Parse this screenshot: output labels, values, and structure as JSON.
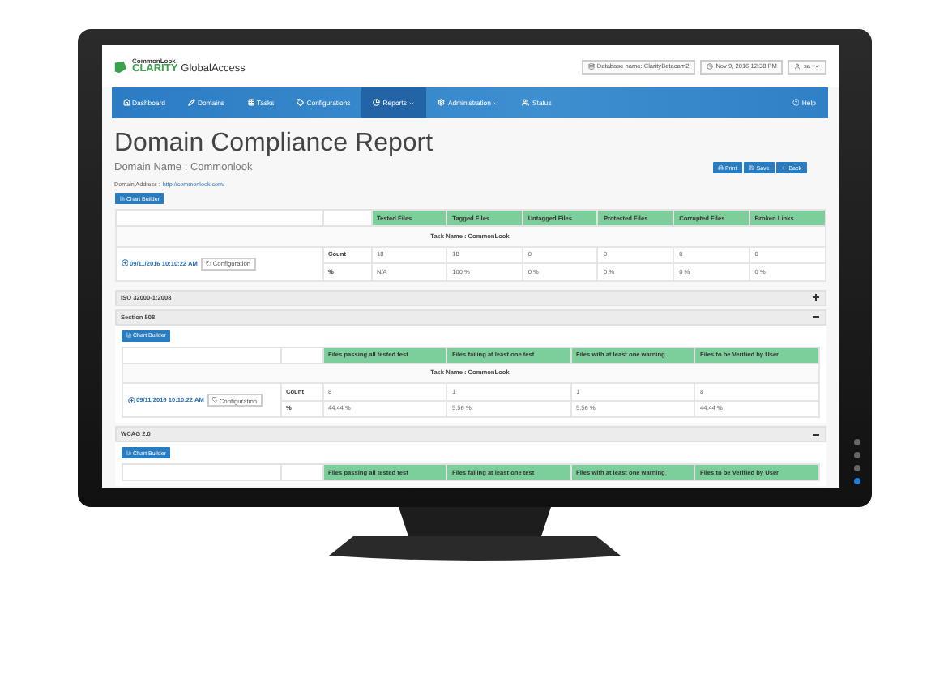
{
  "header": {
    "logo_small": "CommonLook",
    "logo_brand": "CLARITY",
    "logo_product": "GlobalAccess",
    "database": "Database name: ClarityBetacam2",
    "datetime": "Nov 9, 2016 12:38 PM",
    "user": "sa"
  },
  "nav": {
    "items": [
      {
        "label": "Dashboard",
        "selected": false,
        "dropdown": false
      },
      {
        "label": "Domains",
        "selected": false,
        "dropdown": false
      },
      {
        "label": "Tasks",
        "selected": false,
        "dropdown": false
      },
      {
        "label": "Configurations",
        "selected": false,
        "dropdown": false
      },
      {
        "label": "Reports",
        "selected": true,
        "dropdown": true
      },
      {
        "label": "Administration",
        "selected": false,
        "dropdown": true
      },
      {
        "label": "Status",
        "selected": false,
        "dropdown": false
      }
    ],
    "help": "Help"
  },
  "page": {
    "title": "Domain Compliance Report",
    "domain_name": "Domain Name : Commonlook",
    "domain_address_label": "Domain Address :",
    "domain_address_link": "http://commonlook.com/",
    "actions": [
      "Print",
      "Save",
      "Back"
    ],
    "chart_builder": "Chart Builder"
  },
  "summary": {
    "columns": [
      "Tested Files",
      "Tagged Files",
      "Untagged Files",
      "Protected Files",
      "Corrupted Files",
      "Broken Links"
    ],
    "task_name": "Task Name : CommonLook",
    "run_date": "09/11/2016 10:10:22 AM",
    "config": "Configuration",
    "rows": [
      {
        "label": "Count",
        "cells": [
          "18",
          "18",
          "0",
          "0",
          "0",
          "0"
        ]
      },
      {
        "label": "%",
        "cells": [
          "N/A",
          "100 %",
          "0 %",
          "0 %",
          "0 %",
          "0 %"
        ]
      }
    ]
  },
  "sections": [
    {
      "title": "ISO 32000-1:2008",
      "expanded": false
    },
    {
      "title": "Section 508",
      "expanded": true,
      "chart_builder": "Chart Builder",
      "columns": [
        "Files passing all tested test",
        "Files failing at least one test",
        "Files with at least one warning",
        "Files to be Verified by User"
      ],
      "task_name": "Task Name : CommonLook",
      "run_date": "09/11/2016 10:10:22 AM",
      "config": "Configuration",
      "rows": [
        {
          "label": "Count",
          "cells": [
            "8",
            "1",
            "1",
            "8"
          ]
        },
        {
          "label": "%",
          "cells": [
            "44.44 %",
            "5.56 %",
            "5.56 %",
            "44.44 %"
          ]
        }
      ]
    },
    {
      "title": "WCAG 2.0",
      "expanded": true,
      "chart_builder": "Chart Builder",
      "columns": [
        "Files passing all tested test",
        "Files failing at least one test",
        "Files with at least one warning",
        "Files to be Verified by User"
      ]
    }
  ]
}
